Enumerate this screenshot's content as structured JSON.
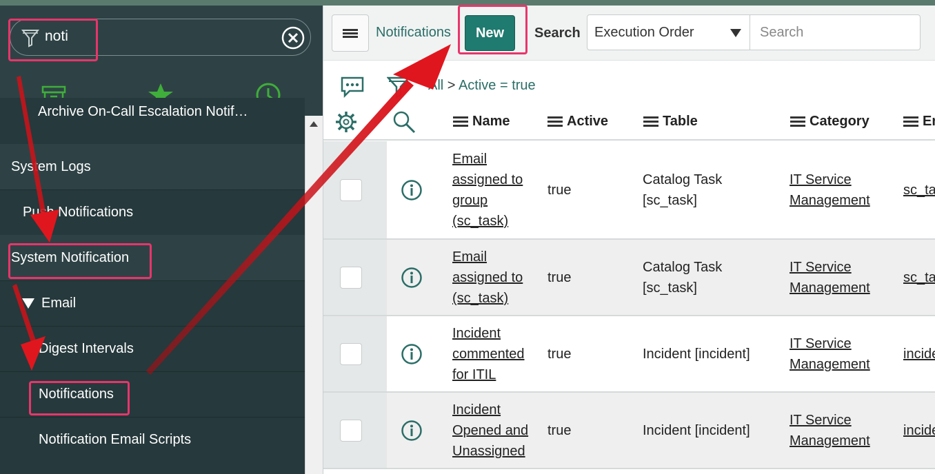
{
  "sidebar": {
    "filter_value": "noti",
    "items": [
      {
        "label": "Archive On-Call Escalation Notif…"
      },
      {
        "label": "System Logs"
      },
      {
        "label": "Push Notifications"
      },
      {
        "label": "System Notification"
      },
      {
        "label": "Email"
      },
      {
        "label": "Digest Intervals"
      },
      {
        "label": "Notifications"
      },
      {
        "label": "Notification Email Scripts"
      }
    ]
  },
  "topbar": {
    "list_title": "Notifications",
    "new_label": "New",
    "search_label": "Search",
    "search_field": "Execution Order",
    "search_placeholder": "Search"
  },
  "breadcrumb": {
    "all": "All",
    "separator": ">",
    "condition": "Active = true"
  },
  "columns": [
    "Name",
    "Active",
    "Table",
    "Category",
    "En"
  ],
  "rows": [
    {
      "name": [
        "Email",
        "assigned to",
        "group",
        "(sc_task)"
      ],
      "active": "true",
      "table": [
        "Catalog Task",
        "[sc_task]"
      ],
      "category": [
        "IT Service",
        "Management"
      ],
      "extra": "sc_ta"
    },
    {
      "name": [
        "Email",
        "assigned to",
        "(sc_task)"
      ],
      "active": "true",
      "table": [
        "Catalog Task",
        "[sc_task]"
      ],
      "category": [
        "IT Service",
        "Management"
      ],
      "extra": "sc_ta"
    },
    {
      "name": [
        "Incident",
        "commented",
        "for ITIL"
      ],
      "active": "true",
      "table": [
        "Incident [incident]"
      ],
      "category": [
        "IT Service",
        "Management"
      ],
      "extra": "incide"
    },
    {
      "name": [
        "Incident",
        "Opened and",
        "Unassigned"
      ],
      "active": "true",
      "table": [
        "Incident [incident]"
      ],
      "category": [
        "IT Service",
        "Management"
      ],
      "extra": "incide"
    }
  ],
  "colors": {
    "sidebar_bg": "#26393c",
    "accent_green": "#1f7a6f",
    "link_teal": "#2b6e67",
    "highlight_pink": "#e8356b",
    "arrow_red": "#e0161e",
    "favorites_green": "#3fae3a"
  }
}
